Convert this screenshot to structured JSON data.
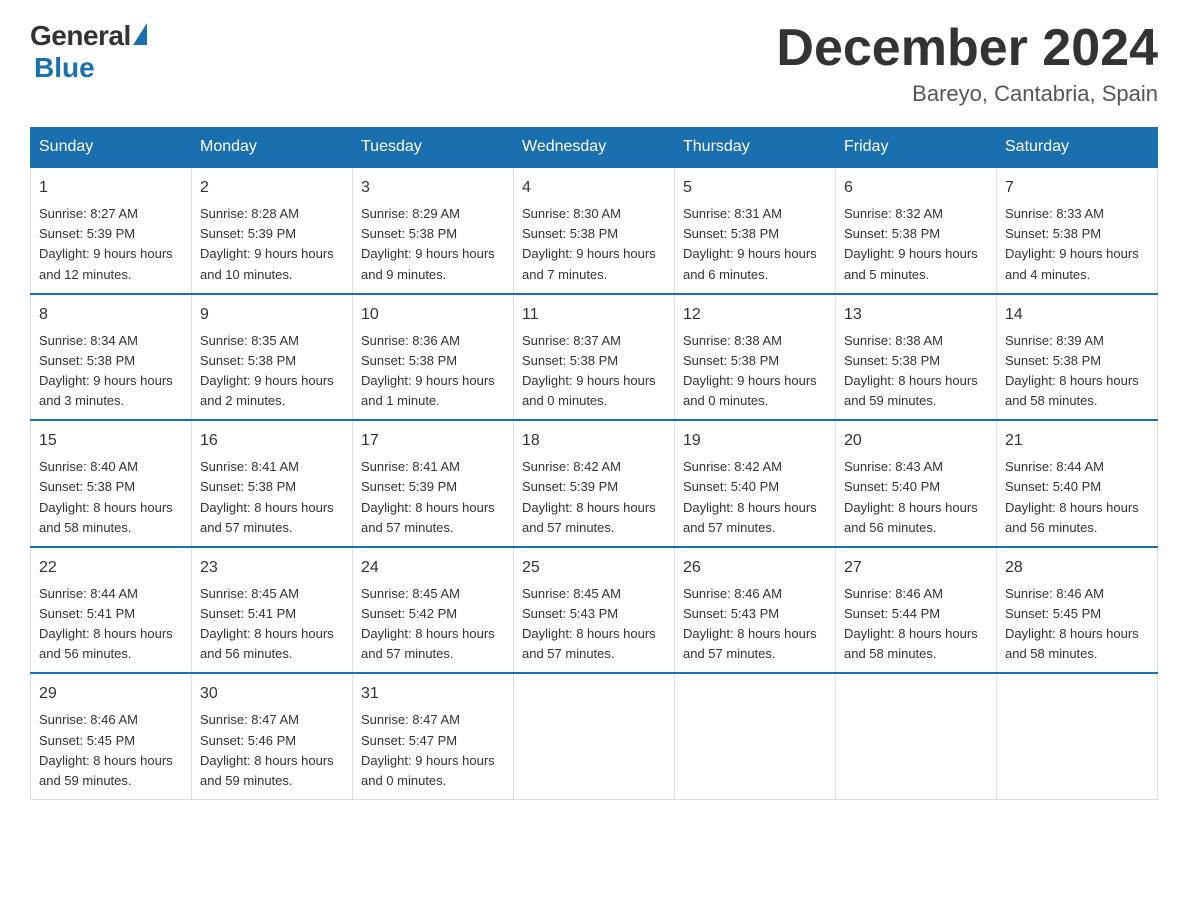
{
  "logo": {
    "general": "General",
    "blue": "Blue",
    "underline": "Blue"
  },
  "header": {
    "month_year": "December 2024",
    "location": "Bareyo, Cantabria, Spain"
  },
  "weekdays": [
    "Sunday",
    "Monday",
    "Tuesday",
    "Wednesday",
    "Thursday",
    "Friday",
    "Saturday"
  ],
  "weeks": [
    [
      {
        "day": "1",
        "sunrise": "8:27 AM",
        "sunset": "5:39 PM",
        "daylight": "9 hours and 12 minutes."
      },
      {
        "day": "2",
        "sunrise": "8:28 AM",
        "sunset": "5:39 PM",
        "daylight": "9 hours and 10 minutes."
      },
      {
        "day": "3",
        "sunrise": "8:29 AM",
        "sunset": "5:38 PM",
        "daylight": "9 hours and 9 minutes."
      },
      {
        "day": "4",
        "sunrise": "8:30 AM",
        "sunset": "5:38 PM",
        "daylight": "9 hours and 7 minutes."
      },
      {
        "day": "5",
        "sunrise": "8:31 AM",
        "sunset": "5:38 PM",
        "daylight": "9 hours and 6 minutes."
      },
      {
        "day": "6",
        "sunrise": "8:32 AM",
        "sunset": "5:38 PM",
        "daylight": "9 hours and 5 minutes."
      },
      {
        "day": "7",
        "sunrise": "8:33 AM",
        "sunset": "5:38 PM",
        "daylight": "9 hours and 4 minutes."
      }
    ],
    [
      {
        "day": "8",
        "sunrise": "8:34 AM",
        "sunset": "5:38 PM",
        "daylight": "9 hours and 3 minutes."
      },
      {
        "day": "9",
        "sunrise": "8:35 AM",
        "sunset": "5:38 PM",
        "daylight": "9 hours and 2 minutes."
      },
      {
        "day": "10",
        "sunrise": "8:36 AM",
        "sunset": "5:38 PM",
        "daylight": "9 hours and 1 minute."
      },
      {
        "day": "11",
        "sunrise": "8:37 AM",
        "sunset": "5:38 PM",
        "daylight": "9 hours and 0 minutes."
      },
      {
        "day": "12",
        "sunrise": "8:38 AM",
        "sunset": "5:38 PM",
        "daylight": "9 hours and 0 minutes."
      },
      {
        "day": "13",
        "sunrise": "8:38 AM",
        "sunset": "5:38 PM",
        "daylight": "8 hours and 59 minutes."
      },
      {
        "day": "14",
        "sunrise": "8:39 AM",
        "sunset": "5:38 PM",
        "daylight": "8 hours and 58 minutes."
      }
    ],
    [
      {
        "day": "15",
        "sunrise": "8:40 AM",
        "sunset": "5:38 PM",
        "daylight": "8 hours and 58 minutes."
      },
      {
        "day": "16",
        "sunrise": "8:41 AM",
        "sunset": "5:38 PM",
        "daylight": "8 hours and 57 minutes."
      },
      {
        "day": "17",
        "sunrise": "8:41 AM",
        "sunset": "5:39 PM",
        "daylight": "8 hours and 57 minutes."
      },
      {
        "day": "18",
        "sunrise": "8:42 AM",
        "sunset": "5:39 PM",
        "daylight": "8 hours and 57 minutes."
      },
      {
        "day": "19",
        "sunrise": "8:42 AM",
        "sunset": "5:40 PM",
        "daylight": "8 hours and 57 minutes."
      },
      {
        "day": "20",
        "sunrise": "8:43 AM",
        "sunset": "5:40 PM",
        "daylight": "8 hours and 56 minutes."
      },
      {
        "day": "21",
        "sunrise": "8:44 AM",
        "sunset": "5:40 PM",
        "daylight": "8 hours and 56 minutes."
      }
    ],
    [
      {
        "day": "22",
        "sunrise": "8:44 AM",
        "sunset": "5:41 PM",
        "daylight": "8 hours and 56 minutes."
      },
      {
        "day": "23",
        "sunrise": "8:45 AM",
        "sunset": "5:41 PM",
        "daylight": "8 hours and 56 minutes."
      },
      {
        "day": "24",
        "sunrise": "8:45 AM",
        "sunset": "5:42 PM",
        "daylight": "8 hours and 57 minutes."
      },
      {
        "day": "25",
        "sunrise": "8:45 AM",
        "sunset": "5:43 PM",
        "daylight": "8 hours and 57 minutes."
      },
      {
        "day": "26",
        "sunrise": "8:46 AM",
        "sunset": "5:43 PM",
        "daylight": "8 hours and 57 minutes."
      },
      {
        "day": "27",
        "sunrise": "8:46 AM",
        "sunset": "5:44 PM",
        "daylight": "8 hours and 58 minutes."
      },
      {
        "day": "28",
        "sunrise": "8:46 AM",
        "sunset": "5:45 PM",
        "daylight": "8 hours and 58 minutes."
      }
    ],
    [
      {
        "day": "29",
        "sunrise": "8:46 AM",
        "sunset": "5:45 PM",
        "daylight": "8 hours and 59 minutes."
      },
      {
        "day": "30",
        "sunrise": "8:47 AM",
        "sunset": "5:46 PM",
        "daylight": "8 hours and 59 minutes."
      },
      {
        "day": "31",
        "sunrise": "8:47 AM",
        "sunset": "5:47 PM",
        "daylight": "9 hours and 0 minutes."
      },
      null,
      null,
      null,
      null
    ]
  ],
  "labels": {
    "sunrise": "Sunrise:",
    "sunset": "Sunset:",
    "daylight": "Daylight:"
  },
  "colors": {
    "header_bg": "#1a6faf",
    "accent": "#1a6faf"
  }
}
